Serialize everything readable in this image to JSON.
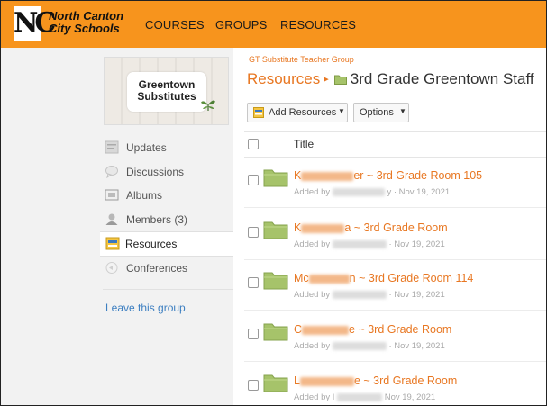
{
  "header": {
    "school_name_line1": "North Canton",
    "school_name_line2": "City Schools",
    "logo_letters": "NC",
    "nav": [
      "COURSES",
      "GROUPS",
      "RESOURCES"
    ],
    "bar_color": "#f7941d"
  },
  "sidebar": {
    "group_logo_line1": "Greentown",
    "group_logo_line2": "Substitutes",
    "items": [
      {
        "label": "Updates",
        "icon": "updates-icon"
      },
      {
        "label": "Discussions",
        "icon": "discussions-icon"
      },
      {
        "label": "Albums",
        "icon": "albums-icon"
      },
      {
        "label": "Members (3)",
        "icon": "members-icon"
      },
      {
        "label": "Resources",
        "icon": "resources-icon",
        "active": true
      },
      {
        "label": "Conferences",
        "icon": "conferences-icon"
      }
    ],
    "leave_label": "Leave this group"
  },
  "main": {
    "group_name": "GT Substitute Teacher Group",
    "breadcrumb_root": "Resources",
    "breadcrumb_sep": "▸",
    "breadcrumb_current": "3rd Grade Greentown Staff",
    "add_resources_label": "Add Resources",
    "options_label": "Options",
    "column_title": "Title",
    "accent_color": "#e87722",
    "rows": [
      {
        "name_prefix": "K",
        "name_suffix": "er ~ 3rd Grade Room 105",
        "meta_prefix": "Added by",
        "meta_suffix": "y · Nov 19, 2021"
      },
      {
        "name_prefix": "K",
        "name_suffix": "a ~ 3rd Grade Room",
        "meta_prefix": "Added by",
        "meta_suffix": "· Nov 19, 2021"
      },
      {
        "name_prefix": "Mc",
        "name_suffix": "n ~ 3rd Grade Room 114",
        "meta_prefix": "Added by",
        "meta_suffix": "· Nov 19, 2021"
      },
      {
        "name_prefix": "C",
        "name_suffix": "e ~ 3rd Grade Room",
        "meta_prefix": "Added by",
        "meta_suffix": "· Nov 19, 2021"
      },
      {
        "name_prefix": "L",
        "name_suffix": "e ~ 3rd Grade Room",
        "meta_prefix": "Added by I",
        "meta_suffix": "Nov 19, 2021"
      }
    ]
  }
}
